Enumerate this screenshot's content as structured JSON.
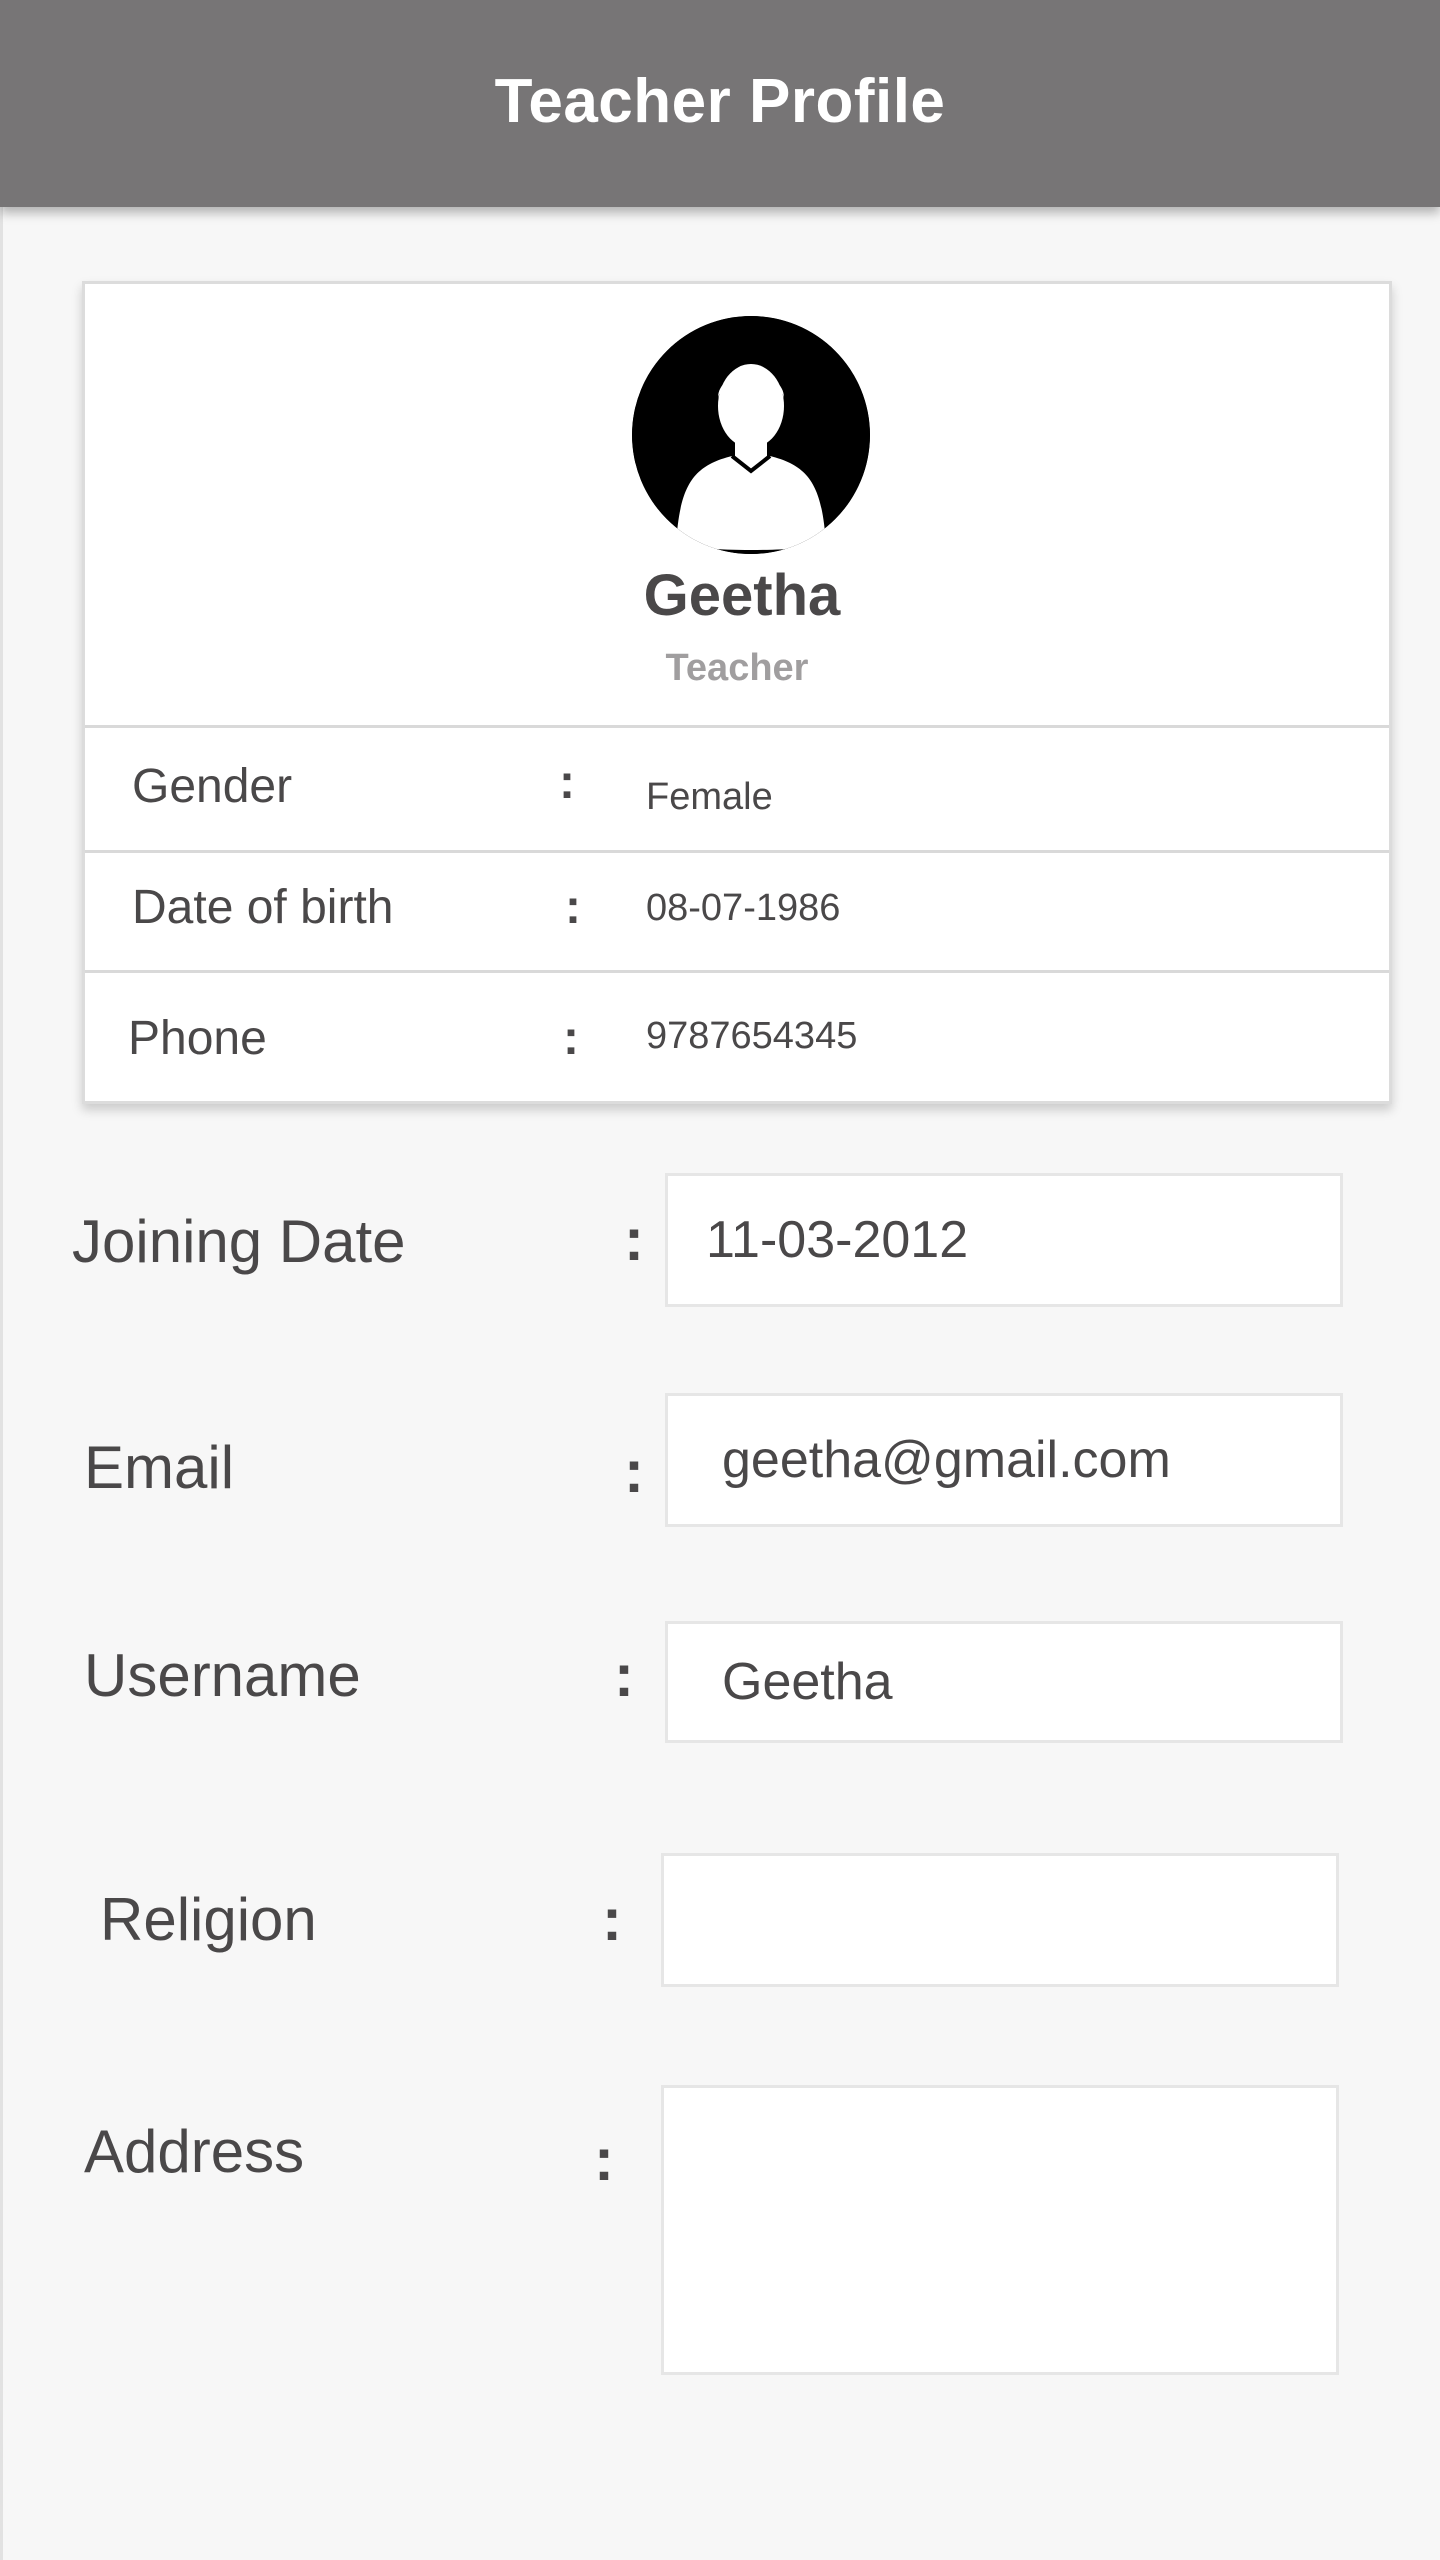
{
  "appbar": {
    "title": "Teacher Profile"
  },
  "profile": {
    "avatar_icon": "user-silhouette-icon",
    "name": "Geetha",
    "role": "Teacher",
    "info": [
      {
        "label": "Gender",
        "value": "Female"
      },
      {
        "label": "Date of birth",
        "value": "08-07-1986"
      },
      {
        "label": "Phone",
        "value": "9787654345"
      }
    ]
  },
  "form": {
    "joining_date": {
      "label": "Joining Date",
      "value": "11-03-2012"
    },
    "email": {
      "label": "Email",
      "value": "geetha@gmail.com"
    },
    "username": {
      "label": "Username",
      "value": "Geetha"
    },
    "religion": {
      "label": "Religion",
      "value": ""
    },
    "address": {
      "label": "Address",
      "value": ""
    }
  },
  "separator": ":",
  "colors": {
    "appbar": "#777576",
    "background": "#f7f7f7",
    "text": "#4a4849",
    "muted": "#a09e9f"
  }
}
